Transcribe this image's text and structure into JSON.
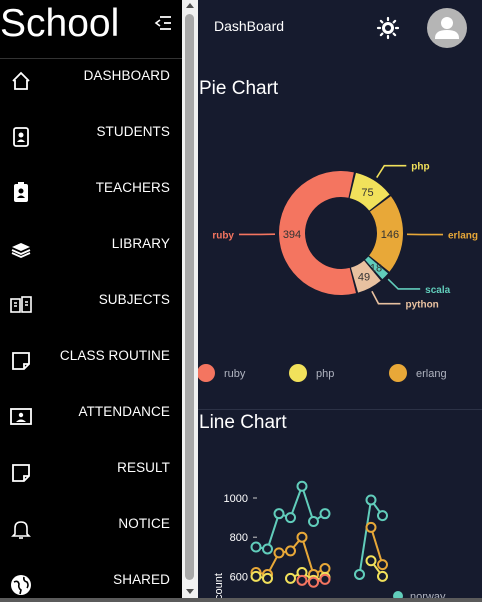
{
  "brand": {
    "title": "School"
  },
  "topbar": {
    "title": "DashBoard"
  },
  "nav": [
    {
      "label": "DASHBOARD",
      "icon": "home-icon"
    },
    {
      "label": "STUDENTS",
      "icon": "student-badge-icon"
    },
    {
      "label": "TEACHERS",
      "icon": "teacher-badge-icon"
    },
    {
      "label": "LIBRARY",
      "icon": "books-icon"
    },
    {
      "label": "SUBJECTS",
      "icon": "subjects-icon"
    },
    {
      "label": "CLASS ROUTINE",
      "icon": "note-icon"
    },
    {
      "label": "ATTENDANCE",
      "icon": "attendance-icon"
    },
    {
      "label": "RESULT",
      "icon": "note-icon"
    },
    {
      "label": "NOTICE",
      "icon": "bell-icon"
    },
    {
      "label": "SHARED",
      "icon": "globe-icon"
    }
  ],
  "pie": {
    "title": "Pie Chart",
    "chart_data": {
      "type": "pie",
      "slices": [
        {
          "label": "ruby",
          "value": 394,
          "color": "#f47560"
        },
        {
          "label": "php",
          "value": 75,
          "color": "#f1e15b"
        },
        {
          "label": "erlang",
          "value": 146,
          "color": "#e8a838"
        },
        {
          "label": "scala",
          "value": 18,
          "color": "#61cdbb"
        },
        {
          "label": "python",
          "value": 49,
          "color": "#e8c1a0"
        }
      ],
      "legend": [
        "ruby",
        "php",
        "erlang"
      ],
      "legend_position": "bottom"
    }
  },
  "line": {
    "title": "Line Chart",
    "chart_data": {
      "type": "line",
      "ylabel": "count",
      "yticks": [
        600,
        800,
        1000
      ],
      "legend_partial": "norway",
      "series": [
        {
          "color": "#61cdbb",
          "points": [
            [
              0,
              750
            ],
            [
              1,
              740
            ],
            [
              2,
              920
            ],
            [
              3,
              900
            ],
            [
              4,
              1060
            ],
            [
              5,
              880
            ],
            [
              6,
              920
            ],
            [
              9,
              610
            ],
            [
              10,
              990
            ],
            [
              11,
              910
            ]
          ]
        },
        {
          "color": "#e8a838",
          "points": [
            [
              0,
              620
            ],
            [
              1,
              610
            ],
            [
              2,
              720
            ],
            [
              3,
              730
            ],
            [
              4,
              800
            ],
            [
              5,
              610
            ],
            [
              6,
              640
            ],
            [
              10,
              850
            ],
            [
              11,
              660
            ]
          ]
        },
        {
          "color": "#f1e15b",
          "points": [
            [
              0,
              600
            ],
            [
              1,
              590
            ],
            [
              3,
              590
            ],
            [
              4,
              620
            ],
            [
              5,
              580
            ],
            [
              6,
              595
            ],
            [
              10,
              680
            ],
            [
              11,
              600
            ]
          ]
        },
        {
          "color": "#f47560",
          "points": [
            [
              4,
              580
            ],
            [
              5,
              570
            ],
            [
              6,
              585
            ]
          ]
        }
      ]
    }
  }
}
